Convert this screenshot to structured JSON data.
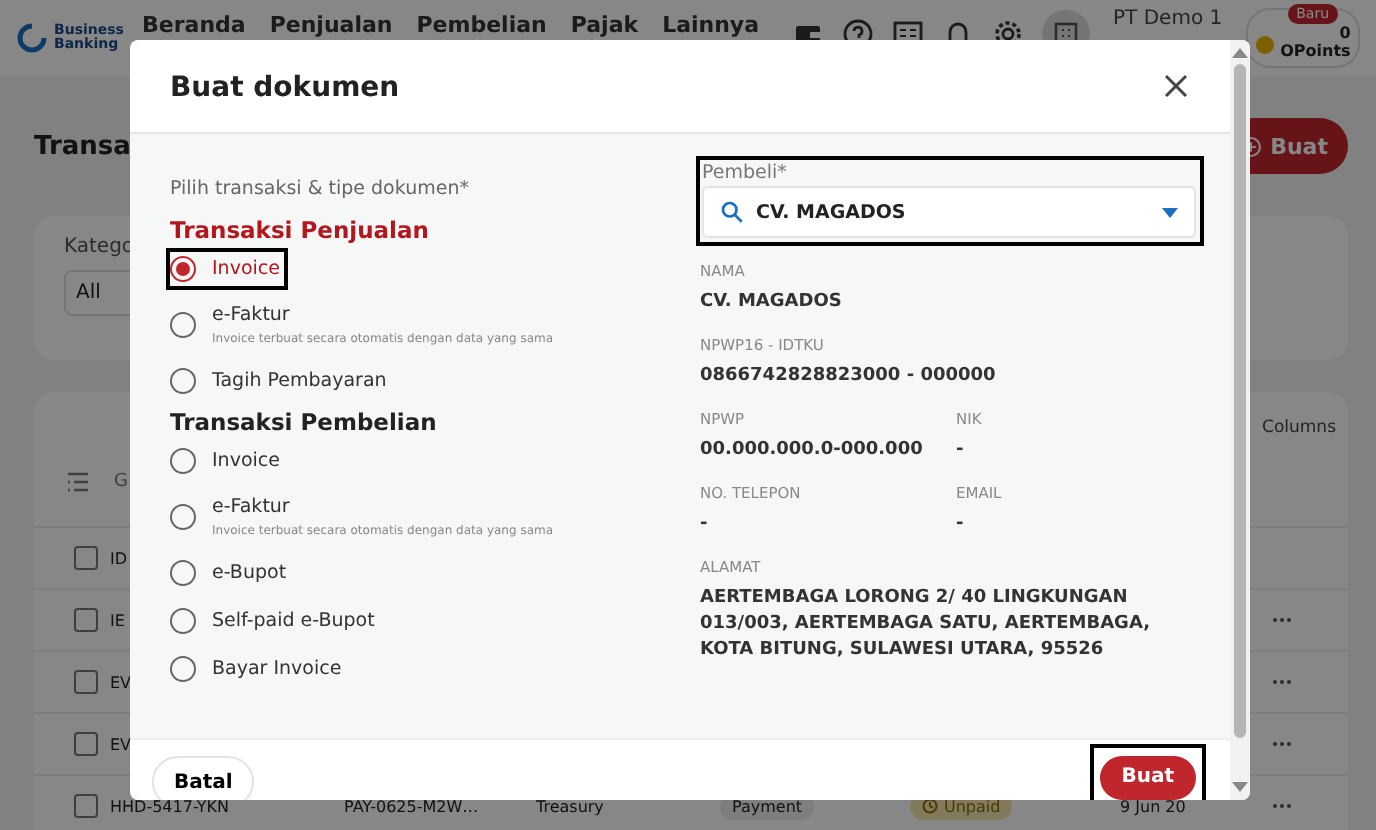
{
  "header": {
    "logo": "Business Banking",
    "nav": [
      {
        "label": "Beranda"
      },
      {
        "label": "Penjualan"
      },
      {
        "label": "Pembelian"
      },
      {
        "label": "Pajak"
      },
      {
        "label": "Lainnya"
      }
    ],
    "company": "PT Demo 1",
    "points": {
      "badge": "Baru",
      "value": "0",
      "label": "OPoints"
    }
  },
  "page": {
    "title": "Transa",
    "create_button": "Buat",
    "filter": {
      "label": "Katego",
      "value": "All"
    },
    "columns_button": "Columns",
    "table": {
      "group_header": "G",
      "id_header": "ID",
      "header_checked": false,
      "rows": [
        {
          "id": "IE",
          "checked": false
        },
        {
          "id": "EV",
          "checked": false
        },
        {
          "id": "EV",
          "checked": false
        },
        {
          "id": "HHD-5417-YKN",
          "checked": false,
          "ref": "PAY-0625-M2W…",
          "source": "Treasury",
          "type": "Payment",
          "status": "Unpaid",
          "date": "9 Jun 20"
        }
      ]
    }
  },
  "dialog": {
    "title": "Buat dokumen",
    "prompt": "Pilih transaksi & tipe dokumen*",
    "groups": [
      {
        "title": "Transaksi Penjualan",
        "active": true,
        "options": [
          {
            "label": "Invoice",
            "selected": true,
            "highlighted": true
          },
          {
            "label": "e-Faktur",
            "note": "Invoice terbuat secara otomatis dengan data yang sama",
            "selected": false,
            "highlighted": false
          },
          {
            "label": "Tagih Pembayaran",
            "selected": false,
            "highlighted": false
          }
        ]
      },
      {
        "title": "Transaksi Pembelian",
        "active": false,
        "options": [
          {
            "label": "Invoice",
            "selected": false,
            "highlighted": false
          },
          {
            "label": "e-Faktur",
            "note": "Invoice terbuat secara otomatis dengan data yang sama",
            "selected": false,
            "highlighted": false
          },
          {
            "label": "e-Bupot",
            "selected": false,
            "highlighted": false
          },
          {
            "label": "Self-paid e-Bupot",
            "selected": false,
            "highlighted": false
          },
          {
            "label": "Bayar Invoice",
            "selected": false,
            "highlighted": false
          }
        ]
      }
    ],
    "buyer": {
      "label": "Pembeli*",
      "value": "CV. MAGADOS",
      "highlighted": true
    },
    "details": [
      {
        "label": "NAMA",
        "value": "CV. MAGADOS",
        "kind": "wide"
      },
      {
        "label": "NPWP16 - IDTKU",
        "value": "0866742828823000 - 000000",
        "kind": "wide"
      },
      {
        "label": "NPWP",
        "value": "00.000.000.0-000.000",
        "kind": "half"
      },
      {
        "label": "NIK",
        "value": "-",
        "kind": "half"
      },
      {
        "label": "NO. TELEPON",
        "value": "-",
        "kind": "half"
      },
      {
        "label": "EMAIL",
        "value": "-",
        "kind": "half"
      },
      {
        "label": "ALAMAT",
        "value": "AERTEMBAGA LORONG 2/ 40 LINGKUNGAN 013/003, AERTEMBAGA SATU, AERTEMBAGA, KOTA BITUNG, SULAWESI UTARA, 95526",
        "kind": "wide"
      }
    ],
    "cancel": "Batal",
    "submit": {
      "label": "Buat",
      "highlighted": true
    }
  }
}
